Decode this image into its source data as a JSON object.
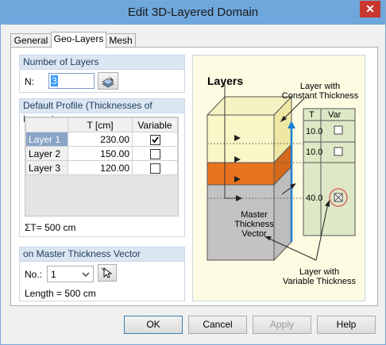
{
  "window": {
    "title": "Edit 3D-Layered Domain",
    "close": "✕"
  },
  "tabs": [
    {
      "label": "General"
    },
    {
      "label": "Geo-Layers"
    },
    {
      "label": "Mesh"
    }
  ],
  "num_layers": {
    "heading": "Number of Layers",
    "label": "N:",
    "value": "3"
  },
  "profile": {
    "heading": "Default Profile (Thicknesses of Layers)",
    "columns": [
      "",
      "T [cm]",
      "Variable"
    ],
    "rows": [
      {
        "name": "Layer 1",
        "t": "230.00",
        "variable": true
      },
      {
        "name": "Layer 2",
        "t": "150.00",
        "variable": false
      },
      {
        "name": "Layer 3",
        "t": "120.00",
        "variable": false
      }
    ],
    "sum": "ΣT= 500 cm"
  },
  "vector": {
    "heading": "on Master Thickness Vector",
    "no_label": "No.:",
    "no_value": "1",
    "length": "Length = 500 cm"
  },
  "diagram": {
    "title": "Layers",
    "const_label": [
      "Layer with",
      "Constant Thickness"
    ],
    "col_t": "T",
    "col_var": "Var",
    "values": [
      "10.0",
      "10.0",
      "40.0"
    ],
    "master_label": [
      "Master",
      "Thickness",
      "Vector"
    ],
    "var_label": [
      "Layer with",
      "Variable Thickness"
    ]
  },
  "buttons": {
    "ok": "OK",
    "cancel": "Cancel",
    "apply": "Apply",
    "help": "Help"
  }
}
